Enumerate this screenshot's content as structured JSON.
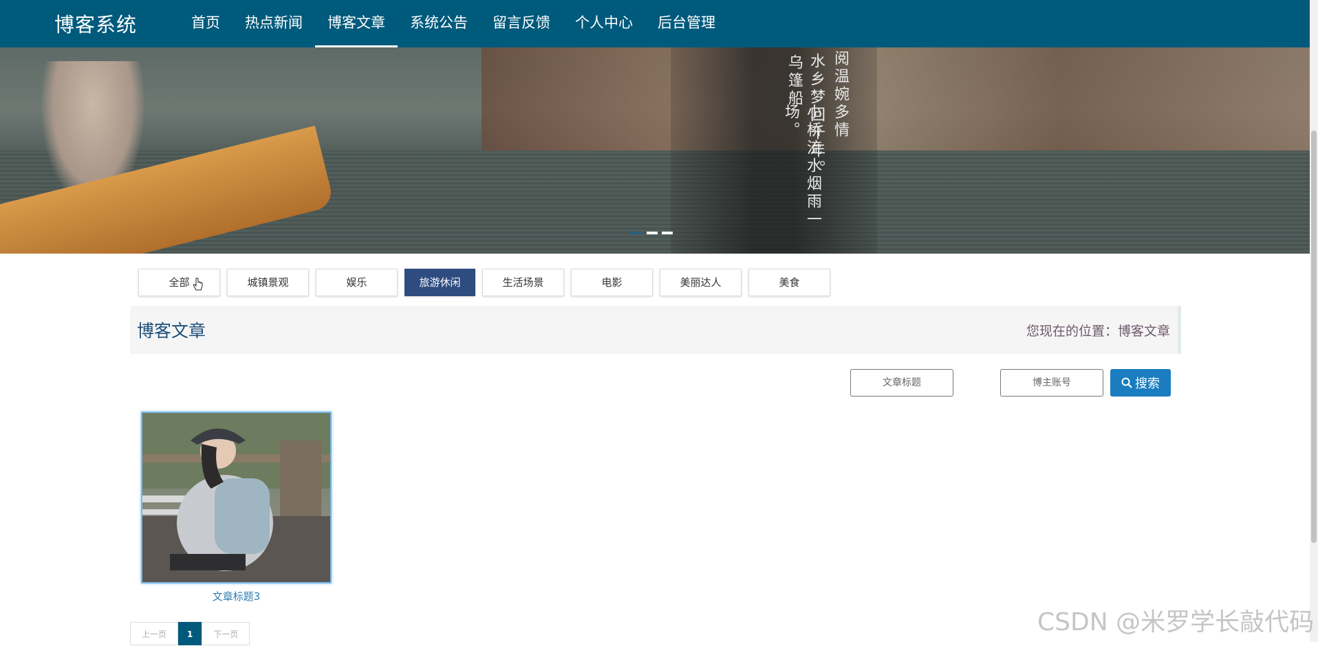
{
  "brand": "博客系统",
  "nav": {
    "items": [
      {
        "label": "首页"
      },
      {
        "label": "热点新闻"
      },
      {
        "label": "博客文章"
      },
      {
        "label": "系统公告"
      },
      {
        "label": "留言反馈"
      },
      {
        "label": "个人中心"
      },
      {
        "label": "后台管理"
      }
    ],
    "active": "博客文章"
  },
  "banner": {
    "poem_lines": [
      "乌篷船",
      "水乡梦回千年。",
      "阅温婉多情",
      "小桥流水烟雨一场。"
    ],
    "slide_count": 3,
    "active_slide": 1
  },
  "categories": {
    "items": [
      {
        "label": "全部"
      },
      {
        "label": "城镇景观"
      },
      {
        "label": "娱乐"
      },
      {
        "label": "旅游休闲"
      },
      {
        "label": "生活场景"
      },
      {
        "label": "电影"
      },
      {
        "label": "美丽达人"
      },
      {
        "label": "美食"
      }
    ],
    "active": "旅游休闲"
  },
  "section": {
    "title": "博客文章",
    "location_prefix": "您现在的位置：",
    "location_current": "博客文章"
  },
  "search": {
    "title_placeholder": "文章标题",
    "author_placeholder": "博主账号",
    "button_label": "搜索"
  },
  "articles": [
    {
      "title": "文章标题3"
    }
  ],
  "pagination": {
    "prev": "上一页",
    "current": "1",
    "next": "下一页"
  },
  "watermark": "CSDN @米罗学长敲代码",
  "colors": {
    "nav_bg": "#005a7c",
    "active_category": "#2e4c80",
    "search_button": "#1a7dbf",
    "link": "#2f7dae"
  }
}
